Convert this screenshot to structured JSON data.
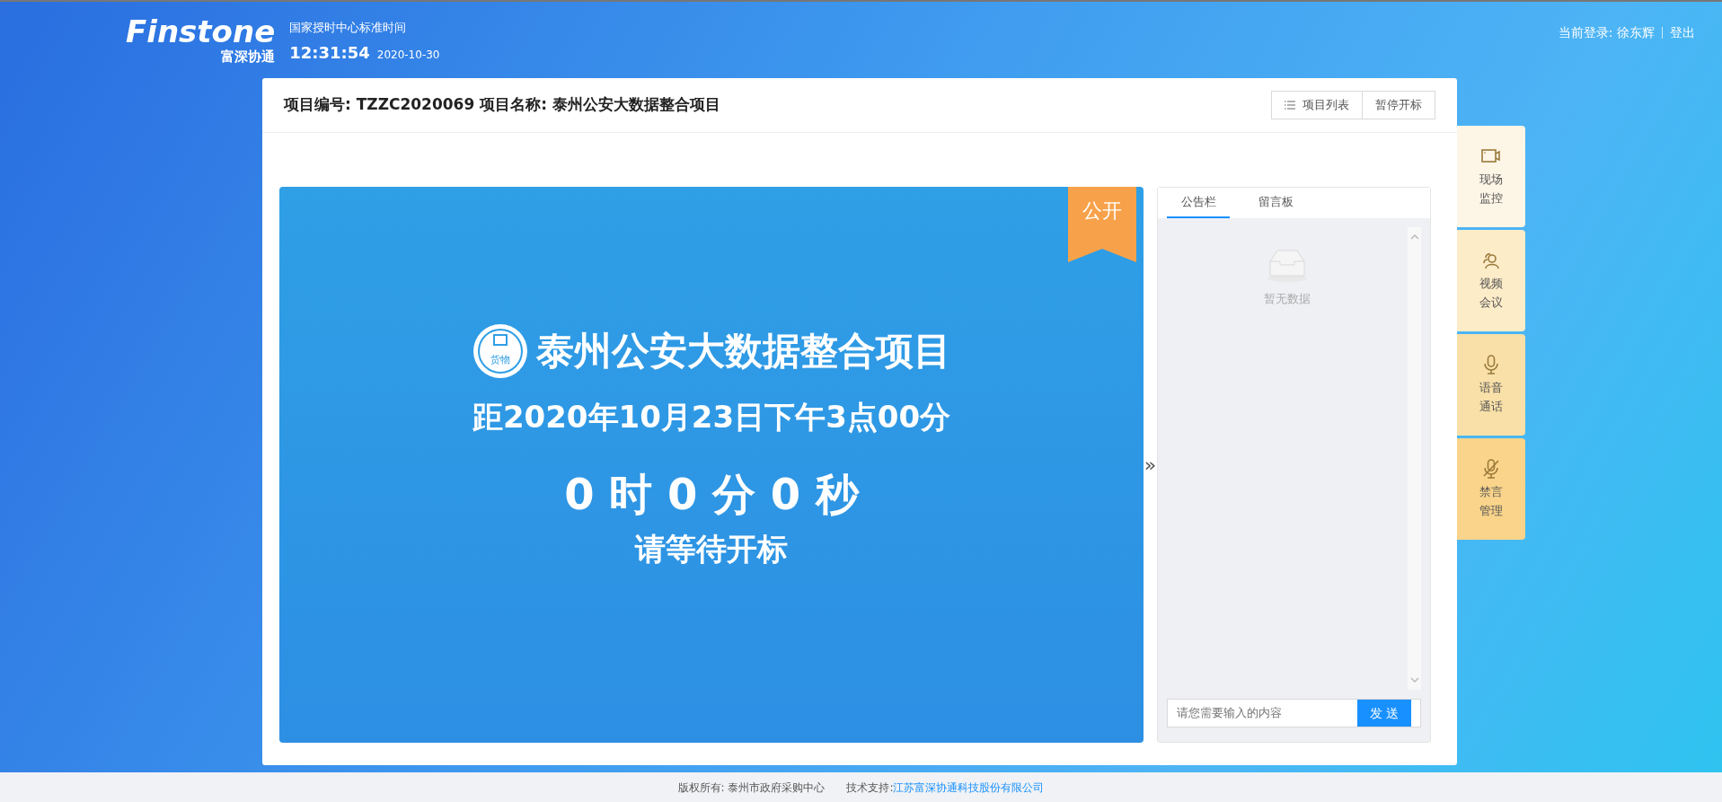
{
  "header": {
    "logo_text": "Finstone",
    "logo_subtitle": "富深协通",
    "time_label": "国家授时中心标准时间",
    "time": "12:31:54",
    "date": "2020-10-30",
    "login_label": "当前登录: 徐东辉",
    "logout": "登出"
  },
  "title": {
    "text": "项目编号: TZZC2020069 项目名称: 泰州公安大数据整合项目",
    "buttons": [
      {
        "label": "项目列表",
        "kind": "list"
      },
      {
        "label": "暂停开标",
        "kind": "plain"
      }
    ]
  },
  "stage": {
    "tag": "公开",
    "category": "货物",
    "project_name": "泰州公安大数据整合项目",
    "deadline": "距2020年10月23日下午3点00分",
    "countdown": "0 时 0 分 0 秒",
    "status": "请等待开标"
  },
  "collapse_toggle": "»",
  "board": {
    "tabs": [
      {
        "label": "公告栏",
        "selected": true
      },
      {
        "label": "留言板",
        "selected": false
      }
    ],
    "empty_text": "暂无数据",
    "input": {
      "placeholder": "请您需要输入的内容"
    },
    "send_button": "发 送"
  },
  "side_tools": [
    {
      "label": "现场监控",
      "kind": "camera",
      "color": "#fdf5e6"
    },
    {
      "label": "视频会议",
      "kind": "people",
      "color": "#fdecc8"
    },
    {
      "label": "语音通话",
      "kind": "mic",
      "color": "#f9e0a8"
    },
    {
      "label": "禁言管理",
      "kind": "mic-off",
      "color": "#f9d48a"
    }
  ],
  "footer": {
    "copyright": "版权所有: 泰州市政府采购中心",
    "support_label": "技术支持:",
    "support_link": "江苏富深协通科技股份有限公司"
  }
}
